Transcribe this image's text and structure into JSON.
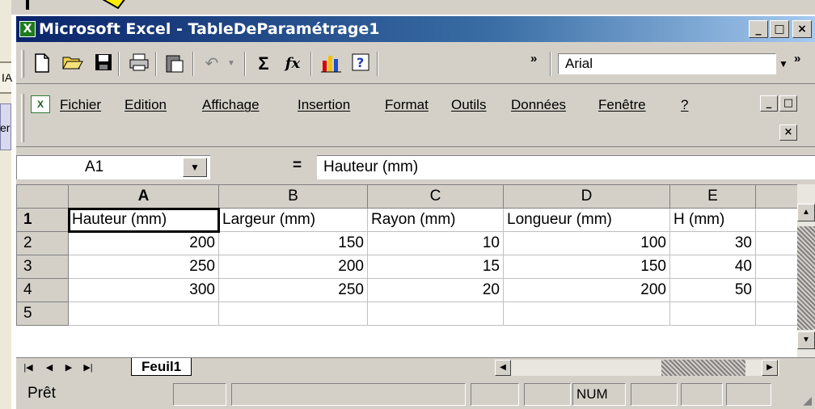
{
  "window": {
    "title": "Microsoft Excel - TableDeParamétrage1",
    "app_icon": "X",
    "buttons": {
      "minimize": "_",
      "maximize": "□",
      "close": "×"
    }
  },
  "background": {
    "text1": "IA",
    "text2": "er"
  },
  "toolbar": {
    "icons": [
      "new-document-icon",
      "open-folder-icon",
      "save-icon",
      "print-icon",
      "paste-icon",
      "undo-icon",
      "autosum-icon",
      "function-icon",
      "chart-wizard-icon",
      "help-icon"
    ],
    "autosum": "Σ",
    "function": "fx",
    "more": "»",
    "font_name": "Arial"
  },
  "menu": {
    "items": [
      "Fichier",
      "Edition",
      "Affichage",
      "Insertion",
      "Format",
      "Outils",
      "Données",
      "Fenêtre",
      "?"
    ]
  },
  "formula_bar": {
    "cell_ref": "A1",
    "equals": "=",
    "content": "Hauteur (mm)"
  },
  "sheet": {
    "column_headers": [
      "A",
      "B",
      "C",
      "D",
      "E"
    ],
    "row_headers": [
      "1",
      "2",
      "3",
      "4",
      "5"
    ],
    "rows": [
      [
        "Hauteur (mm)",
        "Largeur (mm)",
        "Rayon (mm)",
        "Longueur (mm)",
        "H (mm)"
      ],
      [
        "200",
        "150",
        "10",
        "100",
        "30"
      ],
      [
        "250",
        "200",
        "15",
        "150",
        "40"
      ],
      [
        "300",
        "250",
        "20",
        "200",
        "50"
      ],
      [
        "",
        "",
        "",
        "",
        ""
      ]
    ]
  },
  "tabs": {
    "active_sheet": "Feuil1"
  },
  "status": {
    "text": "Prêt",
    "num_indicator": "NUM"
  }
}
